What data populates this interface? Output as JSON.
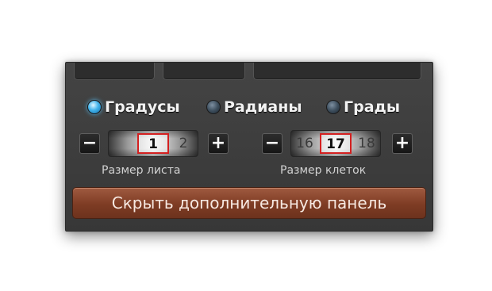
{
  "angle_modes": [
    {
      "label": "Градусы",
      "selected": true
    },
    {
      "label": "Радианы",
      "selected": false
    },
    {
      "label": "Грады",
      "selected": false
    }
  ],
  "sheet_size": {
    "minus_label": "−",
    "plus_label": "+",
    "values": [
      "1",
      "2"
    ],
    "selected_value": "1",
    "caption": "Размер листа"
  },
  "cell_size": {
    "minus_label": "−",
    "plus_label": "+",
    "values": [
      "16",
      "17",
      "18"
    ],
    "selected_value": "17",
    "caption": "Размер клеток"
  },
  "hide_panel_button": {
    "label": "Скрыть дополнительную панель"
  },
  "colors": {
    "panel_bg": "#3f3f3f",
    "radio_active": "#43b4ec",
    "selection_border": "#d42020",
    "hide_button": "#8b452b"
  }
}
